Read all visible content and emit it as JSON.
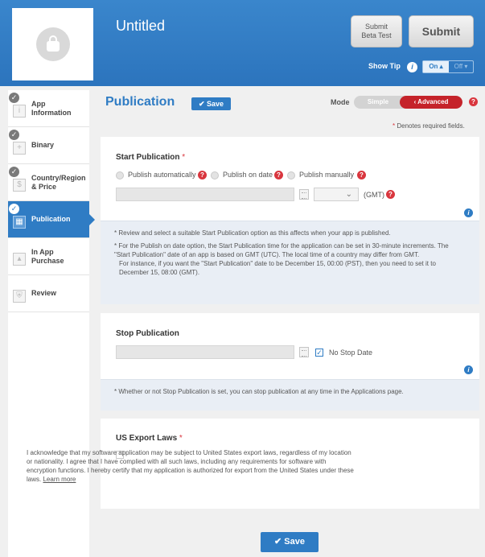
{
  "header": {
    "app_title": "Untitled",
    "beta_button": "Submit\nBeta Test",
    "submit_button": "Submit",
    "show_tip_label": "Show Tip",
    "toggle_on": "On ▴",
    "toggle_off": "Off ▾"
  },
  "sidebar": {
    "items": [
      {
        "label": "App\nInformation",
        "checked": true,
        "icon": "info-icon",
        "active": false
      },
      {
        "label": "Binary",
        "checked": true,
        "icon": "binary-icon",
        "active": false
      },
      {
        "label": "Country/Region\n& Price",
        "checked": true,
        "icon": "dollar-icon",
        "active": false
      },
      {
        "label": "Publication",
        "checked": true,
        "icon": "calendar-icon",
        "active": true
      },
      {
        "label": "In App\nPurchase",
        "checked": false,
        "icon": "chart-icon",
        "active": false
      },
      {
        "label": "Review",
        "checked": false,
        "icon": "shield-icon",
        "active": false
      }
    ]
  },
  "main": {
    "title": "Publication",
    "save_top": "✔ Save",
    "mode_label": "Mode",
    "mode_simple": "Simple",
    "mode_advanced": "‹ Advanced",
    "required_note": "Denotes required fields.",
    "required_star": "*"
  },
  "start_publication": {
    "title": "Start Publication",
    "required": "*",
    "options": [
      "Publish automatically",
      "Publish on date",
      "Publish manually"
    ],
    "timezone": "(GMT)",
    "notes": [
      "Review and select a suitable Start Publication option as this affects when your app is published.",
      "For the Publish on date option, the Start Publication time for the application can be set in 30-minute increments. The \"Start Publication\" date of an app is based on GMT (UTC). The local time of a country may differ from GMT.",
      "For instance, if you want the \"Start Publication\" date to be December 15, 00:00 (PST), then you need to set it to December 15, 08:00 (GMT)."
    ]
  },
  "stop_publication": {
    "title": "Stop Publication",
    "no_stop_date": "No Stop Date",
    "note": "Whether or not Stop Publication is set, you can stop publication at any time in the Applications page."
  },
  "export_laws": {
    "title": "US Export Laws",
    "required": "*",
    "text": "I acknowledge that my software application may be subject to United States export laws, regardless of my location or nationality. I agree that I have complied with all such laws, including any requirements for software with encryption functions. I hereby certify that my application is authorized for export from the United States under these laws.",
    "learn_more": "Learn more"
  },
  "footer": {
    "save_bottom": "✔ Save"
  },
  "colors": {
    "brand_blue": "#2f7cc4",
    "danger_red": "#c5232a"
  }
}
